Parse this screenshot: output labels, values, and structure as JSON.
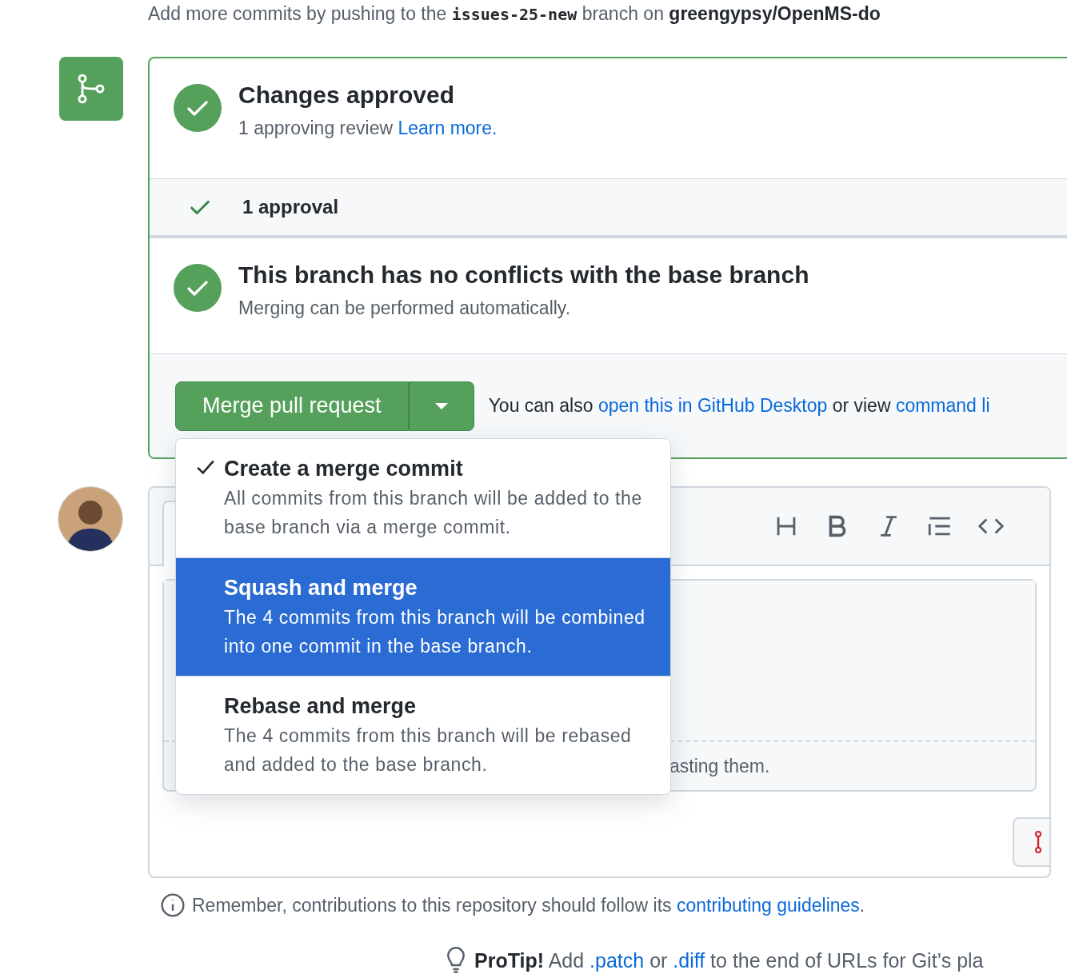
{
  "header": {
    "before": "Add more commits by pushing to the",
    "branch": "issues-25-new",
    "middle": "branch on",
    "repo": "greengypsy/OpenMS-do"
  },
  "merge_box": {
    "sections": [
      {
        "kind": "status",
        "title": "Changes approved",
        "text": "1 approving review",
        "link": "Learn more."
      },
      {
        "kind": "reviews",
        "text": "1 approval"
      },
      {
        "kind": "status",
        "title": "This branch has no conflicts with the base branch",
        "text": "Merging can be performed automatically."
      }
    ],
    "merge_button": {
      "label": "Merge pull request"
    },
    "alternative": {
      "before": "You can also",
      "link1": "open this in GitHub Desktop",
      "middle": "or view",
      "link2": "command li"
    }
  },
  "merge_menu": [
    {
      "title": "Create a merge commit",
      "description": "All commits from this branch will be added to the base branch via a merge commit.",
      "checked": true,
      "selected": false
    },
    {
      "title": "Squash and merge",
      "description": "The 4 commits from this branch will be combined into one commit in the base branch.",
      "checked": false,
      "selected": true
    },
    {
      "title": "Rebase and merge",
      "description": "The 4 commits from this branch will be rebased and added to the base branch.",
      "checked": false,
      "selected": false
    }
  ],
  "comment": {
    "hint_fragment": "asting them."
  },
  "notice": {
    "before": "Remember, contributions to this repository should follow its",
    "link": "contributing guidelines",
    "after": "."
  },
  "protip": {
    "label": "ProTip!",
    "before": "Add",
    "link1": ".patch",
    "middle": "or",
    "link2": ".diff",
    "after": "to the end of URLs for Git’s pla"
  }
}
